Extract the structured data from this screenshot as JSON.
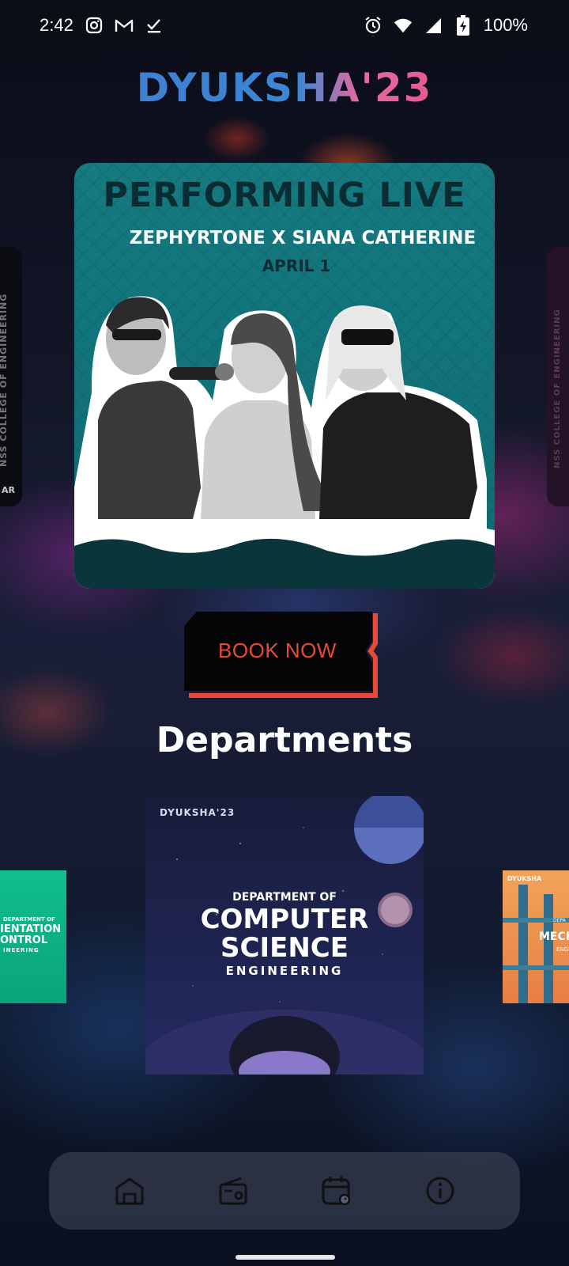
{
  "status_bar": {
    "time": "2:42",
    "battery": "100%",
    "icons": [
      "instagram-icon",
      "gmail-icon",
      "download-done-icon",
      "alarm-icon",
      "wifi-icon",
      "signal-icon",
      "battery-charging-icon"
    ]
  },
  "header": {
    "logo_text": "DYUKSHA'23"
  },
  "side_cards": {
    "left_vertical_text": "NSS COLLEGE OF ENGINEERING",
    "left_corner_text": "AR",
    "right_vertical_text": "NSS COLLEGE OF ENGINEERING"
  },
  "event_card": {
    "headline": "PERFORMING LIVE",
    "artists": "ZEPHYRTONE X SIANA CATHERINE",
    "date": "APRIL 1",
    "accent_color": "#167a80"
  },
  "book_button": {
    "label": "BOOK NOW",
    "accent_color": "#e84a35"
  },
  "departments": {
    "title": "Departments",
    "cards": [
      {
        "logo": "DYUKSHA'23",
        "subtitle": "DEPARTMENT OF",
        "line1": "COMPUTER",
        "line2": "SCIENCE",
        "line3": "ENGINEERING"
      }
    ],
    "left_card": {
      "subtitle": "DEPARTMENT OF",
      "line1": "IENTATION",
      "line2": "ONTROL",
      "line3": "INEERING"
    },
    "right_card": {
      "logo": "DYUKSHA",
      "subtitle": "DEPA",
      "line1": "MECH",
      "line3": "ENGI"
    }
  },
  "bottom_nav": {
    "items": [
      {
        "icon": "home-icon"
      },
      {
        "icon": "radio-icon"
      },
      {
        "icon": "calendar-icon"
      },
      {
        "icon": "info-icon"
      }
    ]
  }
}
